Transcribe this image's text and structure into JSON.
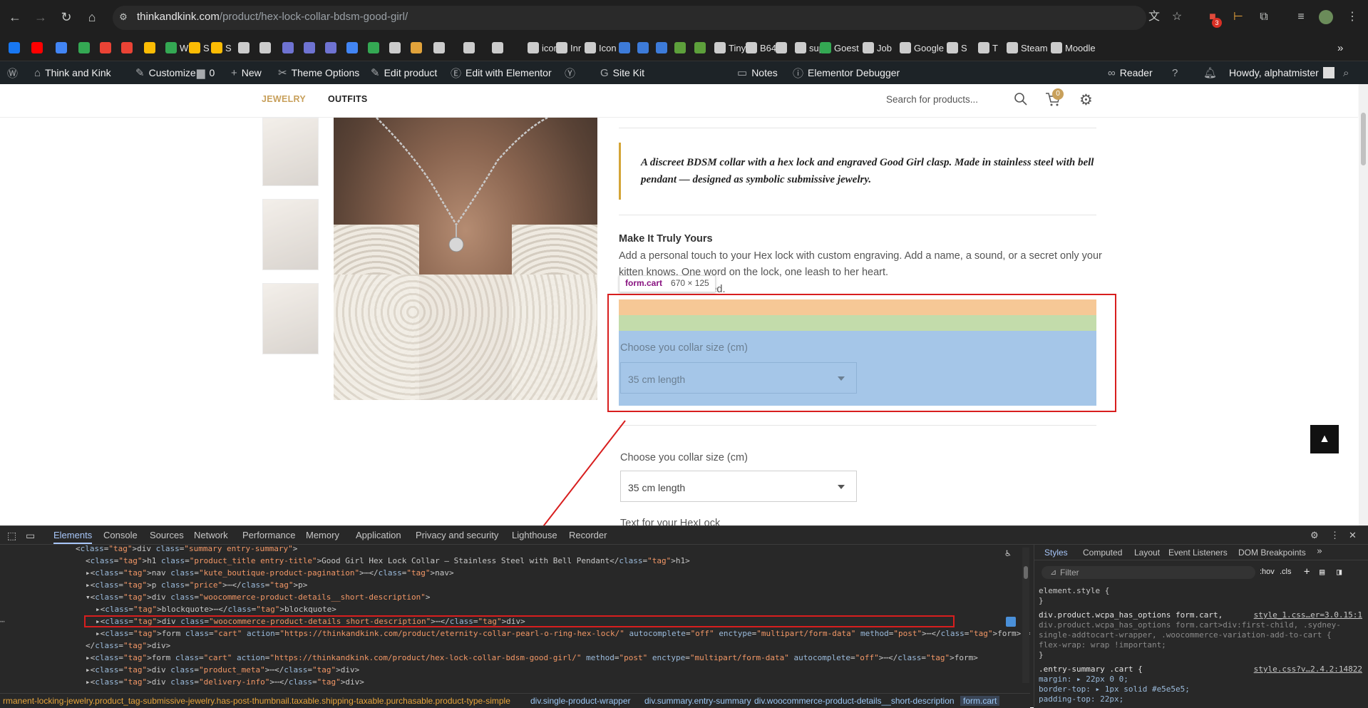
{
  "browser": {
    "url_host": "thinkandkink.com",
    "url_path": "/product/hex-lock-collar-bdsm-good-girl/",
    "extension_badge": "3"
  },
  "bookmarks": [
    {
      "label": "",
      "color": "#1877f2"
    },
    {
      "label": "",
      "color": "#ff0000"
    },
    {
      "label": "",
      "color": "#4285f4"
    },
    {
      "label": "",
      "color": "#34a853"
    },
    {
      "label": "",
      "color": "#ea4335"
    },
    {
      "label": "",
      "color": "#ea4335"
    },
    {
      "label": "",
      "color": "#fbbc04"
    },
    {
      "label": "W",
      "color": "#34a853"
    },
    {
      "label": "S",
      "color": "#fbbc04"
    },
    {
      "label": "S",
      "color": "#fbbc04"
    },
    {
      "label": "",
      "color": "#cccccc"
    },
    {
      "label": "",
      "color": "#cccccc"
    },
    {
      "label": "",
      "color": "#6f73d2"
    },
    {
      "label": "",
      "color": "#6f73d2"
    },
    {
      "label": "",
      "color": "#6f73d2"
    },
    {
      "label": "",
      "color": "#4285f4"
    },
    {
      "label": "",
      "color": "#34a853"
    },
    {
      "label": "",
      "color": "#cccccc"
    },
    {
      "label": "",
      "color": "#e2a33b"
    },
    {
      "label": "",
      "color": "#cccccc"
    },
    {
      "label": "",
      "color": "#cccccc"
    },
    {
      "label": "",
      "color": "#cccccc"
    },
    {
      "label": "icon",
      "color": "#cccccc"
    },
    {
      "label": "Inr",
      "color": "#cccccc"
    },
    {
      "label": "Icon",
      "color": "#cccccc"
    },
    {
      "label": "",
      "color": "#3d7bd9"
    },
    {
      "label": "",
      "color": "#3d7bd9"
    },
    {
      "label": "",
      "color": "#3d7bd9"
    },
    {
      "label": "",
      "color": "#5da03b"
    },
    {
      "label": "",
      "color": "#5da03b"
    },
    {
      "label": "Tiny",
      "color": "#cccccc"
    },
    {
      "label": "B64",
      "color": "#cccccc"
    },
    {
      "label": "",
      "color": "#cccccc"
    },
    {
      "label": "sup",
      "color": "#cccccc"
    },
    {
      "label": "Goest",
      "color": "#34a853"
    },
    {
      "label": "Job",
      "color": "#cccccc"
    },
    {
      "label": "Google",
      "color": "#cccccc"
    },
    {
      "label": "S",
      "color": "#cccccc"
    },
    {
      "label": "T",
      "color": "#cccccc"
    },
    {
      "label": "Steam",
      "color": "#cccccc"
    },
    {
      "label": "Moodle",
      "color": "#cccccc"
    }
  ],
  "wpbar": {
    "site": "Think and Kink",
    "customize": "Customize",
    "comments": "0",
    "new": "New",
    "theme_options": "Theme Options",
    "edit_product": "Edit product",
    "elementor": "Edit with Elementor",
    "site_kit": "Site Kit",
    "notes": "Notes",
    "debugger": "Elementor Debugger",
    "reader": "Reader",
    "howdy": "Howdy, alphatmister"
  },
  "site": {
    "menu": [
      "JEWELRY",
      "OUTFITS"
    ],
    "search_placeholder": "Search for products...",
    "cart_count": "0"
  },
  "product": {
    "quote": "A discreet BDSM collar with a hex lock and engraved Good Girl clasp. Made in stainless steel with bell pendant — designed as symbolic submissive jewelry.",
    "make_title": "Make It Truly Yours",
    "make_text_1": "Add a personal touch to your Hex lock with custom engraving. Add a name, a sound, or a secret only your",
    "make_text_2": "kitten knows. One word on the lock, one leash to her heart.",
    "make_text_3": "rished.",
    "tooltip_name": "form.cart",
    "tooltip_size": "670 × 125",
    "size_label": "Choose you collar size (cm)",
    "size_value": "35 cm length",
    "engrave_label": "Text for your HexLock"
  },
  "devtools": {
    "tabs": [
      "Elements",
      "Console",
      "Sources",
      "Network",
      "Performance",
      "Memory",
      "Application",
      "Privacy and security",
      "Lighthouse",
      "Recorder"
    ],
    "style_tabs": [
      "Styles",
      "Computed",
      "Layout",
      "Event Listeners",
      "DOM Breakpoints"
    ],
    "filter_placeholder": "Filter",
    "hov": ":hov",
    "cls": ".cls",
    "dom": [
      {
        "indent": 0,
        "text": "<div class=\"summary entry-summary\">"
      },
      {
        "indent": 1,
        "text": "<h1 class=\"product_title entry-title\">Good Girl Hex Lock Collar – Stainless Steel with Bell Pendant</h1>"
      },
      {
        "indent": 1,
        "text": "▸<nav class=\"kute_boutique-product-pagination\">⋯</nav>"
      },
      {
        "indent": 1,
        "text": "▸<p class=\"price\">⋯</p>"
      },
      {
        "indent": 1,
        "text": "▾<div class=\"woocommerce-product-details__short-description\">"
      },
      {
        "indent": 2,
        "text": "▸<blockquote>⋯</blockquote>"
      },
      {
        "indent": 2,
        "text": "▸<div class=\"woocommerce-product-details  short-description\">⋯</div>"
      },
      {
        "indent": 2,
        "text": "▸<form class=\"cart\" action=\"https://thinkandkink.com/product/eternity-collar-pearl-o-ring-hex-lock/\" autocomplete=\"off\" enctype=\"multipart/form-data\" method=\"post\">⋯</form> == $0"
      },
      {
        "indent": 1,
        "text": "</div>"
      },
      {
        "indent": 1,
        "text": "▸<form class=\"cart\" action=\"https://thinkandkink.com/product/hex-lock-collar-bdsm-good-girl/\" method=\"post\" enctype=\"multipart/form-data\" autocomplete=\"off\">⋯</form>"
      },
      {
        "indent": 1,
        "text": "▸<div class=\"product_meta\">⋯</div>"
      },
      {
        "indent": 1,
        "text": "▸<div class=\"delivery-info\">⋯</div>"
      }
    ],
    "breadcrumbs": [
      "rmanent-locking-jewelry.product_tag-submissive-jewelry.has-post-thumbnail.taxable.shipping-taxable.purchasable.product-type-simple",
      "div.single-product-wrapper",
      "div.summary.entry-summary",
      "div.woocommerce-product-details__short-description",
      "form.cart"
    ],
    "styles": [
      {
        "t": "element.style {",
        "c": "#c7c7c7"
      },
      {
        "t": "}",
        "c": "#c7c7c7"
      },
      {
        "t": "div.product.wcpa_has_options form.cart,",
        "c": "#e3e3e3",
        "src": "style_1.css…er=3.0.15:1"
      },
      {
        "t": "div.product.wcpa_has_options form.cart>div:first-child, .sydney-",
        "c": "#8a8a8a"
      },
      {
        "t": "single-addtocart-wrapper, .woocommerce-variation-add-to-cart {",
        "c": "#8a8a8a"
      },
      {
        "t": "  flex-wrap: wrap !important;",
        "c": "#8a8a8a"
      },
      {
        "t": "}",
        "c": "#c7c7c7"
      },
      {
        "t": ".entry-summary .cart {",
        "c": "#e3e3e3",
        "src": "style.css?v…2.4.2:14822"
      },
      {
        "t": "  margin: ▸ 22px 0 0;",
        "c": "#9bbbdc"
      },
      {
        "t": "  border-top: ▸ 1px solid  #e5e5e5;",
        "c": "#9bbbdc"
      },
      {
        "t": "  padding-top: 22px;",
        "c": "#9bbbdc"
      }
    ]
  }
}
